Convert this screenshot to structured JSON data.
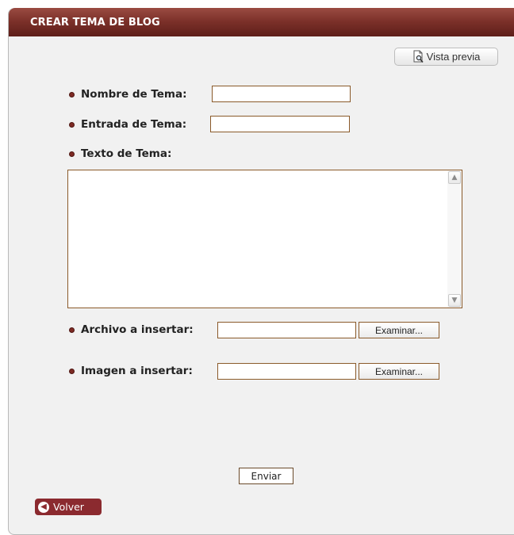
{
  "header": {
    "title": "CREAR TEMA DE BLOG"
  },
  "toolbar": {
    "preview_label": "Vista previa",
    "preview_icon": "document-magnifier-icon"
  },
  "form": {
    "topic_name": {
      "label": "Nombre de Tema:",
      "value": ""
    },
    "topic_entry": {
      "label": "Entrada de Tema:",
      "value": ""
    },
    "topic_text": {
      "label": "Texto de Tema:",
      "value": ""
    },
    "file_attach": {
      "label": "Archivo a insertar:",
      "value": "",
      "browse_label": "Examinar..."
    },
    "image_attach": {
      "label": "Imagen a insertar:",
      "value": "",
      "browse_label": "Examinar..."
    },
    "submit_label": "Enviar"
  },
  "footer": {
    "back_label": "Volver",
    "back_icon": "arrow-left-circle-icon"
  },
  "colors": {
    "header_bg": "#7a2f28",
    "bullet": "#7d2a24",
    "back_button_bg": "#8b2a2f",
    "input_border": "#8a5a2a",
    "panel_bg": "#f1f1f1"
  }
}
